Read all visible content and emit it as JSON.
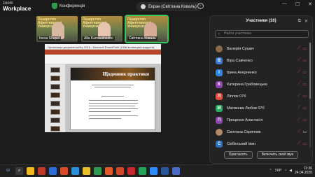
{
  "app": {
    "brand_line1": "zoom",
    "brand_line2": "Workplace"
  },
  "meeting": {
    "title": "Конференція",
    "share_label": "Екран (Світлана Коваль)"
  },
  "window_controls": [
    "—",
    "☐",
    "✕"
  ],
  "thumbs": [
    {
      "name": "Inesa Shepel",
      "banner": "Пекарство\nАфективності\nУніверситету",
      "active": false
    },
    {
      "name": "Alla Kamaushenko",
      "banner": "Пекарство\nАфективності\nУніверситету",
      "active": false
    },
    {
      "name": "Світлана Коваль",
      "banner": "Пекарство\nАфективності\nУніверситету",
      "active": true
    }
  ],
  "shared_doc": {
    "window_title": "Організація документообігу 2016 - Microsoft PowerPoint (Сбій активации продукта)",
    "slide_title": "Щоденник практики"
  },
  "participants": {
    "header": "Участники (16)",
    "search_placeholder": "Найти участника",
    "items": [
      {
        "name": "Валерія Сушич",
        "initial": "",
        "color": "#8a6a4a",
        "photo": true,
        "cam_on": false
      },
      {
        "name": "Віра Савченко",
        "initial": "В",
        "color": "#3b78d8",
        "cam_on": false
      },
      {
        "name": "Ірина Анедченко",
        "initial": "І",
        "color": "#2e86de",
        "cam_on": false
      },
      {
        "name": "Катерина Грабовецька",
        "initial": "К",
        "color": "#8e44ad",
        "cam_on": false
      },
      {
        "name": "Ліплок 07б",
        "initial": "Л",
        "color": "#e74c3c",
        "cam_on": false
      },
      {
        "name": "Матвєєва Любов 07б",
        "initial": "М",
        "color": "#27ae60",
        "cam_on": false
      },
      {
        "name": "Проценко Анастасія",
        "initial": "П",
        "color": "#8e44ad",
        "cam_on": false
      },
      {
        "name": "Світлана Скрипник",
        "initial": "",
        "color": "#b08a6a",
        "photo": true,
        "cam_on": true
      },
      {
        "name": "Скібінський Іван",
        "initial": "С",
        "color": "#2c6fbb",
        "cam_on": false
      }
    ],
    "invite_label": "Пригласить",
    "unmute_label": "Включить свой звук"
  },
  "taskbar": {
    "lang": "УКР",
    "time": "11:36",
    "date": "24.04.2026"
  }
}
